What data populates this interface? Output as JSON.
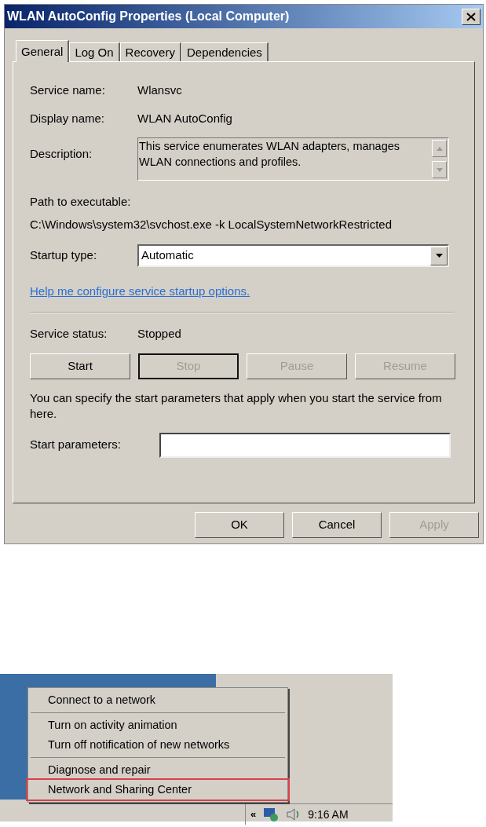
{
  "dialog": {
    "title": "WLAN AutoConfig Properties (Local Computer)"
  },
  "tabs": [
    {
      "label": "General",
      "selected": true
    },
    {
      "label": "Log On",
      "selected": false
    },
    {
      "label": "Recovery",
      "selected": false
    },
    {
      "label": "Dependencies",
      "selected": false
    }
  ],
  "service_name": {
    "label": "Service name:",
    "value": "Wlansvc"
  },
  "display_name": {
    "label": "Display name:",
    "value": "WLAN AutoConfig"
  },
  "description": {
    "label": "Description:",
    "value": "This service enumerates WLAN adapters, manages WLAN connections and profiles."
  },
  "path": {
    "label": "Path to executable:",
    "value": "C:\\Windows\\system32\\svchost.exe -k LocalSystemNetworkRestricted"
  },
  "startup_type": {
    "label": "Startup type:",
    "value": "Automatic"
  },
  "help_link": "Help me configure service startup options.",
  "service_status": {
    "label": "Service status:",
    "value": "Stopped"
  },
  "control_buttons": [
    {
      "label": "Start",
      "disabled": false,
      "focused": false
    },
    {
      "label": "Stop",
      "disabled": true,
      "focused": true
    },
    {
      "label": "Pause",
      "disabled": true,
      "focused": false
    },
    {
      "label": "Resume",
      "disabled": true,
      "focused": false
    }
  ],
  "note": "You can specify the start parameters that apply when you start the service from here.",
  "start_parameters": {
    "label": "Start parameters:"
  },
  "buttons": [
    {
      "label": "OK",
      "disabled": false
    },
    {
      "label": "Cancel",
      "disabled": false
    },
    {
      "label": "Apply",
      "disabled": true
    }
  ],
  "tray_menu": {
    "groups": [
      {
        "items": [
          {
            "label": "Connect to a network",
            "highlighted": false
          }
        ]
      },
      {
        "items": [
          {
            "label": "Turn on activity animation",
            "highlighted": false
          },
          {
            "label": "Turn off notification of new networks",
            "highlighted": false
          }
        ]
      },
      {
        "items": [
          {
            "label": "Diagnose and repair",
            "highlighted": false
          },
          {
            "label": "Network and Sharing Center",
            "highlighted": true
          }
        ]
      }
    ]
  },
  "taskbar": {
    "chevron": "«",
    "time": "9:16 AM"
  }
}
